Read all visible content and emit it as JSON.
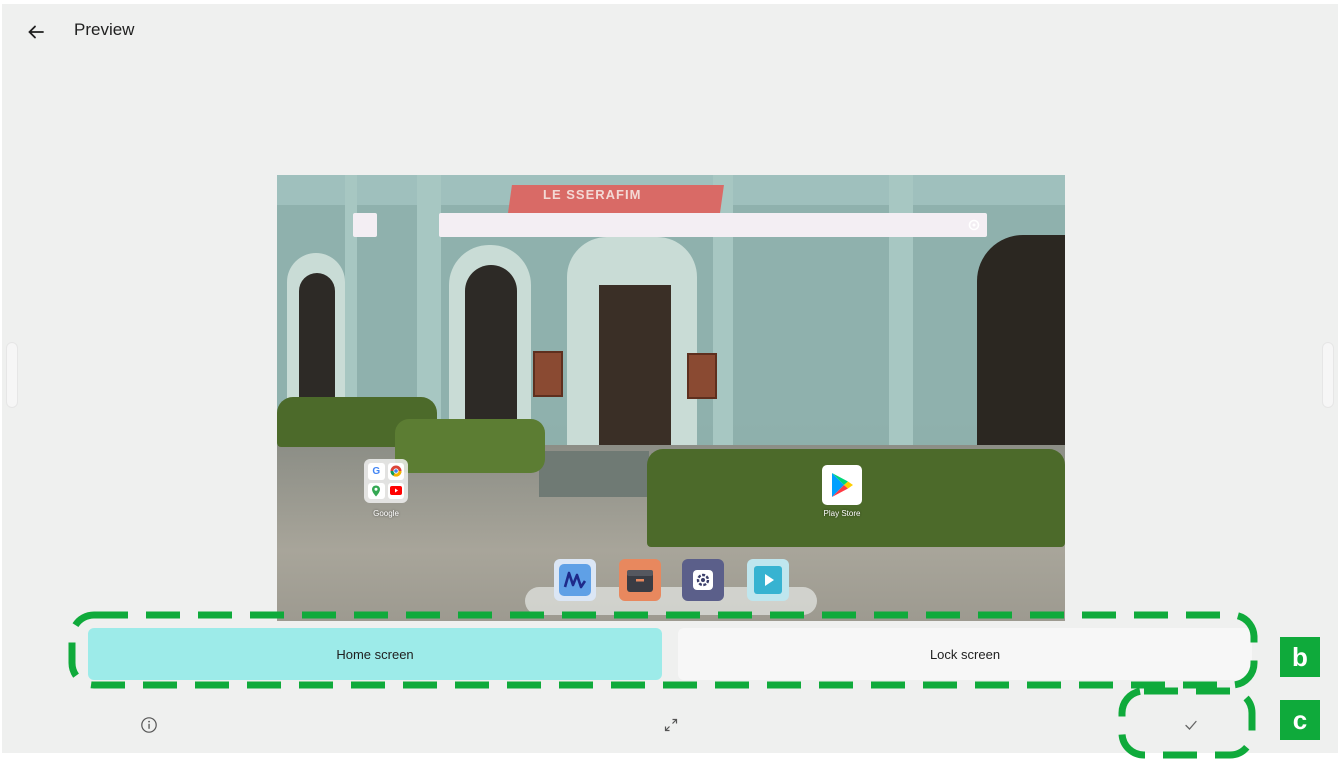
{
  "header": {
    "title": "Preview",
    "back_icon": "arrow-left-icon"
  },
  "preview": {
    "awning_text": "LE SSERAFIM",
    "search_placeholder": "",
    "home_icons": [
      {
        "label": "Google",
        "type": "folder",
        "apps": [
          "G",
          "chrome",
          "maps",
          "youtube"
        ]
      },
      {
        "label": "Play Store",
        "type": "app"
      }
    ],
    "dock_icons": [
      "whiteboard-app-icon",
      "files-app-icon",
      "settings-app-icon",
      "player-app-icon"
    ]
  },
  "tabs": [
    {
      "label": "Home screen",
      "selected": true
    },
    {
      "label": "Lock screen",
      "selected": false
    }
  ],
  "bottom_bar": {
    "info_icon": "info-icon",
    "expand_icon": "expand-icon",
    "apply_icon": "check-icon"
  },
  "annotations": [
    {
      "label": "b"
    },
    {
      "label": "c"
    }
  ],
  "colors": {
    "background": "#eff0ef",
    "selected_tab": "#9debe9",
    "unselected_tab": "#f7f7f7",
    "annotation": "#0faa3b"
  }
}
